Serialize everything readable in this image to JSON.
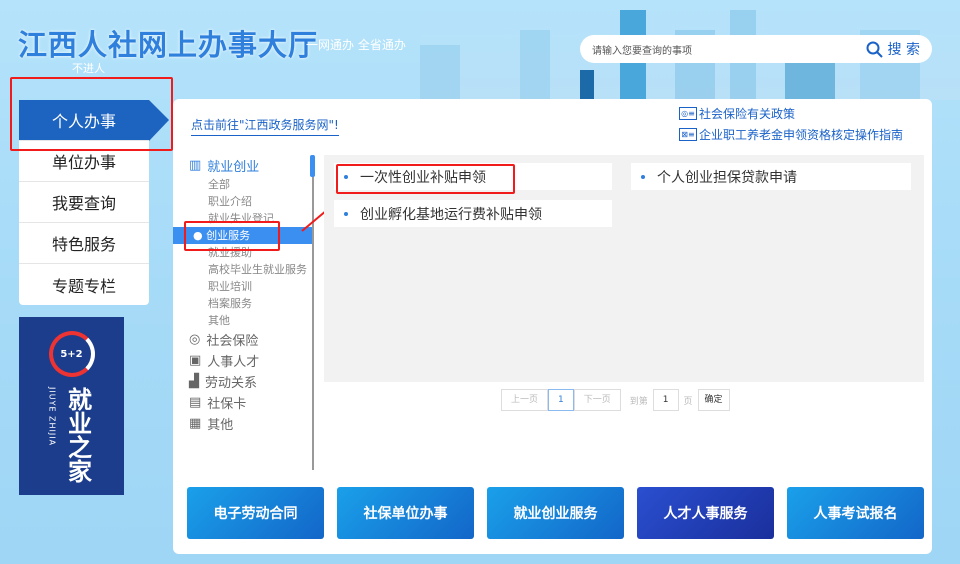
{
  "header": {
    "title": "江西人社网上办事大厅",
    "slogan": "一网通办 全省通办",
    "slogan2": "不进人",
    "search_placeholder": "请输入您要查询的事项",
    "search_button": "搜 索"
  },
  "nav": [
    {
      "label": "个人办事"
    },
    {
      "label": "单位办事"
    },
    {
      "label": "我要查询"
    },
    {
      "label": "特色服务"
    },
    {
      "label": "专题专栏"
    }
  ],
  "promo": {
    "title": "就业之家",
    "pinyin": "JIUYE ZHIJIA",
    "logo": "5+2"
  },
  "main": {
    "gov_link": "点击前往\"江西政务服务网\"!",
    "policy_links": [
      "社会保险有关政策",
      "企业职工养老金申领资格核定操作指南"
    ]
  },
  "tree": {
    "categories": [
      {
        "label": "就业创业",
        "subs": [
          "全部",
          "职业介绍",
          "就业失业登记",
          "创业服务",
          "就业援助",
          "高校毕业生就业服务",
          "职业培训",
          "档案服务",
          "其他"
        ]
      },
      {
        "label": "社会保险"
      },
      {
        "label": "人事人才"
      },
      {
        "label": "劳动关系"
      },
      {
        "label": "社保卡"
      },
      {
        "label": "其他"
      }
    ]
  },
  "services": [
    "一次性创业补贴申领",
    "个人创业担保贷款申请",
    "创业孵化基地运行费补贴申领"
  ],
  "pager": {
    "prev": "上一页",
    "current": "1",
    "next": "下一页",
    "goto": "到第",
    "page_value": "1",
    "page_unit": "页",
    "confirm": "确定"
  },
  "banners": [
    "电子劳动合同",
    "社保单位办事",
    "就业创业服务",
    "人才人事服务",
    "人事考试报名"
  ]
}
